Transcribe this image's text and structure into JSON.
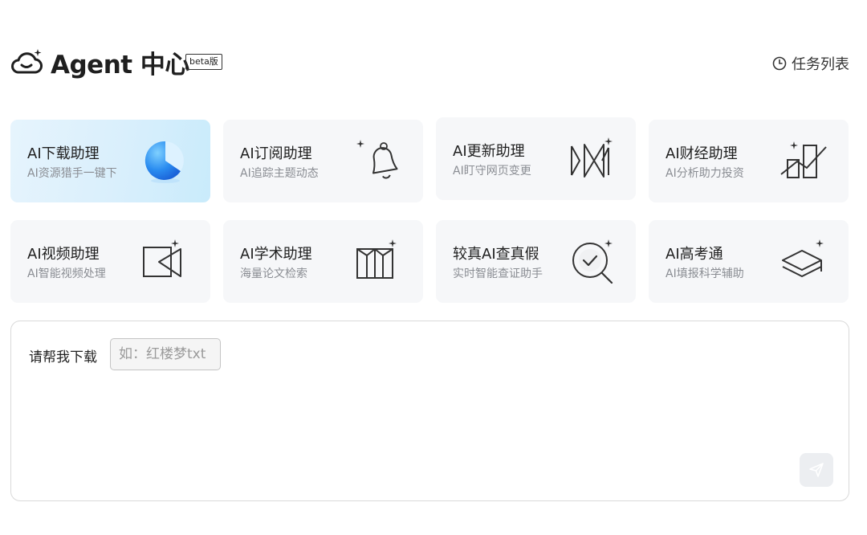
{
  "header": {
    "title": "Agent 中心",
    "badge": "beta版",
    "task_list_label": "任务列表",
    "logo_icon": "cloud-sparkle-icon",
    "task_list_icon": "clock-icon"
  },
  "cards": [
    {
      "title": "AI下载助理",
      "subtitle": "AI资源猎手一键下",
      "icon": "download-orb-icon",
      "active": true
    },
    {
      "title": "AI订阅助理",
      "subtitle": "AI追踪主题动态",
      "icon": "bell-icon",
      "active": false
    },
    {
      "title": "AI更新助理",
      "subtitle": "AI盯守网页变更",
      "icon": "refresh-pages-icon",
      "active": false
    },
    {
      "title": "AI财经助理",
      "subtitle": "AI分析助力投资",
      "icon": "finance-chart-icon",
      "active": false
    },
    {
      "title": "AI视频助理",
      "subtitle": "AI智能视频处理",
      "icon": "video-icon",
      "active": false
    },
    {
      "title": "AI学术助理",
      "subtitle": "海量论文检索",
      "icon": "open-book-icon",
      "active": false
    },
    {
      "title": "较真AI查真假",
      "subtitle": "实时智能查证助手",
      "icon": "magnifier-check-icon",
      "active": false
    },
    {
      "title": "AI高考通",
      "subtitle": "AI填报科学辅助",
      "icon": "graduation-cap-icon",
      "active": false
    }
  ],
  "prompt": {
    "label": "请帮我下载",
    "placeholder": "如：红楼梦txt",
    "value": "",
    "send_icon": "send-icon"
  },
  "colors": {
    "card_bg": "#f6f7f9",
    "active_card_bg": "#d9effc",
    "accent_blue": "#2a8cf0"
  }
}
